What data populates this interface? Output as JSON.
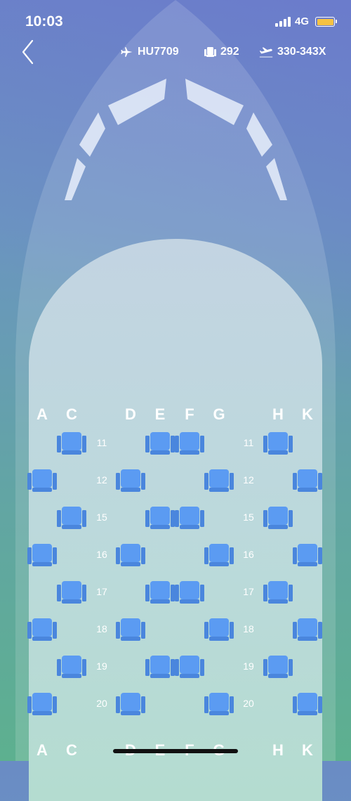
{
  "status_bar": {
    "time": "10:03",
    "network": "4G"
  },
  "flight": {
    "number": "HU7709",
    "seats": "292",
    "aircraft": "330-343X"
  },
  "columns_top": [
    "A",
    "C",
    "D",
    "E",
    "F",
    "G",
    "H",
    "K"
  ],
  "columns_bottom": [
    "A",
    "C",
    "D",
    "E",
    "F",
    "G",
    "H",
    "K"
  ],
  "rows": [
    {
      "number": "11",
      "seats": [
        "C",
        "E",
        "F",
        "H"
      ]
    },
    {
      "number": "12",
      "seats": [
        "A",
        "D",
        "G",
        "K"
      ]
    },
    {
      "number": "15",
      "seats": [
        "C",
        "E",
        "F",
        "H"
      ]
    },
    {
      "number": "16",
      "seats": [
        "A",
        "D",
        "G",
        "K"
      ]
    },
    {
      "number": "17",
      "seats": [
        "C",
        "E",
        "F",
        "H"
      ]
    },
    {
      "number": "18",
      "seats": [
        "A",
        "D",
        "G",
        "K"
      ]
    },
    {
      "number": "19",
      "seats": [
        "C",
        "E",
        "F",
        "H"
      ]
    },
    {
      "number": "20",
      "seats": [
        "A",
        "D",
        "G",
        "K"
      ]
    }
  ],
  "colors": {
    "seat": "#5b9bf2",
    "seat_dark": "#4a86dd",
    "text": "#ffffff"
  },
  "icons": {
    "back": "chevron-left-icon",
    "flight": "airplane-icon",
    "seats": "seat-icon",
    "aircraft": "airplane-takeoff-icon"
  }
}
